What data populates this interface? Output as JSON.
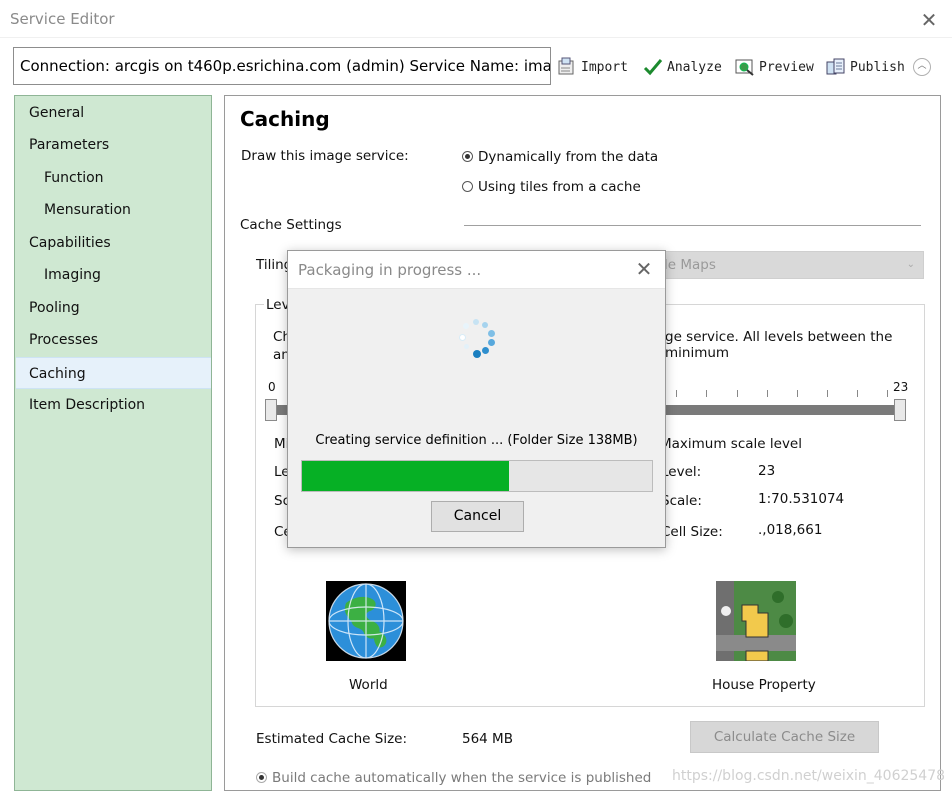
{
  "window": {
    "title": "Service Editor"
  },
  "connection_text": "Connection: arcgis on t460p.esrichina.com (admin)    Service Name: ima...",
  "toolbar": {
    "import": "Import",
    "analyze": "Analyze",
    "preview": "Preview",
    "publish": "Publish"
  },
  "sidebar": {
    "items": [
      {
        "label": "General"
      },
      {
        "label": "Parameters"
      },
      {
        "label": "Function"
      },
      {
        "label": "Mensuration"
      },
      {
        "label": "Capabilities"
      },
      {
        "label": "Imaging"
      },
      {
        "label": "Pooling"
      },
      {
        "label": "Processes"
      },
      {
        "label": "Caching"
      },
      {
        "label": "Item Description"
      }
    ]
  },
  "caching": {
    "title": "Caching",
    "draw_label": "Draw this image service:",
    "radio_dynamic": "Dynamically from the data",
    "radio_tiles": "Using tiles from a cache",
    "cache_settings": "Cache Settings",
    "tiling_label": "Tiling",
    "tiling_value": "le Maps",
    "levels_label": "Lev",
    "desc_left_1": "Ch",
    "desc_left_2": "an",
    "desc_right": "ge service. All levels between the minimum",
    "slider_min": "0",
    "slider_max": "23",
    "min_label_trunc": "Mi",
    "max_label": "Maximum scale level",
    "lev_trunc": "Le",
    "sc_trunc": "Sc",
    "ce_trunc": "Ce",
    "level_label": "Level:",
    "level_value": "23",
    "scale_label": "Scale:",
    "scale_value": "1:70.531074",
    "cellsize_label": "Cell Size:",
    "cellsize_value": ".,018,661",
    "world_caption": "World",
    "house_caption": "House Property",
    "est_label": "Estimated Cache Size:",
    "est_value": "564 MB",
    "calc_button": "Calculate Cache Size",
    "build_cache": "Build cache automatically when the service is published"
  },
  "dialog": {
    "title": "Packaging in progress ...",
    "status": "Creating service definition ... (Folder Size 138MB)",
    "progress": 0.59,
    "cancel": "Cancel"
  },
  "watermark": "https://blog.csdn.net/weixin_40625478",
  "colors": {
    "sidebar_bg": "#cfe8d2",
    "progress_fill": "#06b025",
    "spinner": "#1a7fc0"
  }
}
